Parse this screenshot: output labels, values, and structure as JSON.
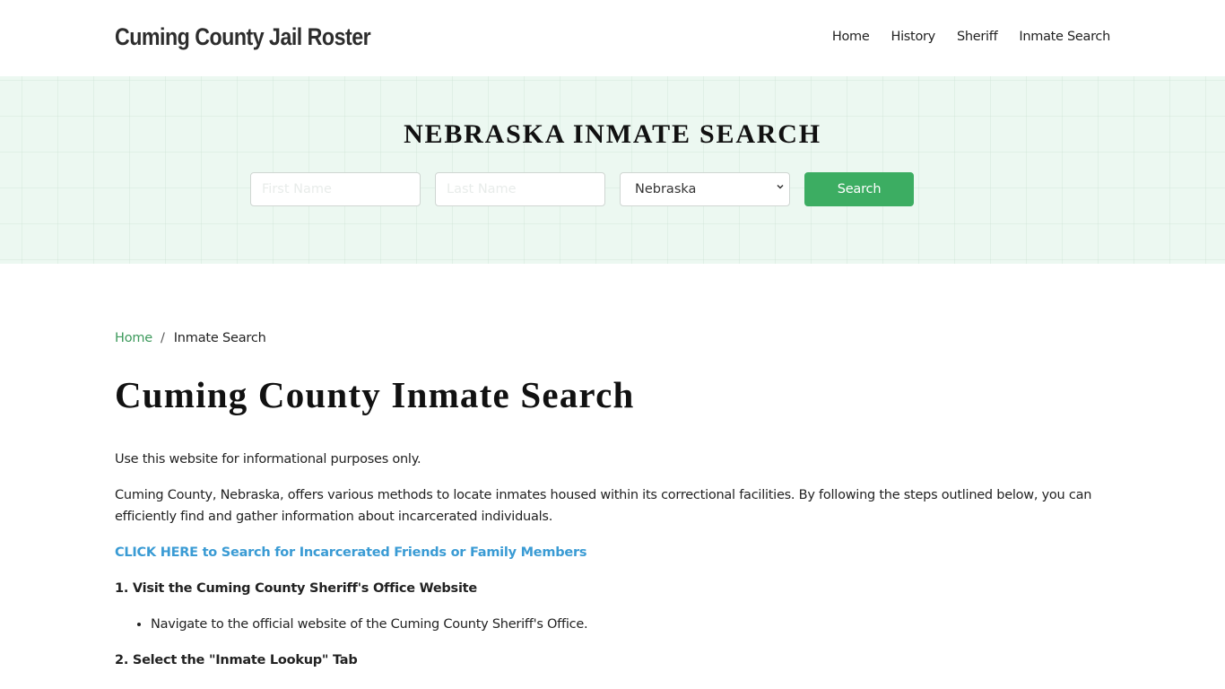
{
  "header": {
    "brand": "Cuming County Jail Roster",
    "nav": [
      {
        "label": "Home"
      },
      {
        "label": "History"
      },
      {
        "label": "Sheriff"
      },
      {
        "label": "Inmate Search"
      }
    ]
  },
  "hero": {
    "title": "NEBRASKA INMATE SEARCH",
    "first_name": {
      "value": "",
      "placeholder": "First Name"
    },
    "last_name": {
      "value": "",
      "placeholder": "Last Name"
    },
    "state_select": {
      "selected": "Nebraska"
    },
    "search_label": "Search",
    "colors": {
      "background": "#ecf8f1",
      "button": "#3cad62"
    }
  },
  "breadcrumb": {
    "home": "Home",
    "separator": "/",
    "current": "Inmate Search"
  },
  "main": {
    "title": "Cuming County Inmate Search",
    "intro": "Use this website for informational purposes only.",
    "description": "Cuming County, Nebraska, offers various methods to locate inmates housed within its correctional facilities. By following the steps outlined below, you can efficiently find and gather information about incarcerated individuals.",
    "cta_link": "CLICK HERE to Search for Incarcerated Friends or Family Members",
    "steps": [
      {
        "heading": "1. Visit the Cuming County Sheriff's Office Website",
        "bullets": [
          "Navigate to the official website of the Cuming County Sheriff's Office."
        ]
      },
      {
        "heading": "2. Select the \"Inmate Lookup\" Tab",
        "bullets": []
      }
    ],
    "colors": {
      "link": "#3a9bd4",
      "breadcrumb_link": "#3d9a5c"
    }
  }
}
